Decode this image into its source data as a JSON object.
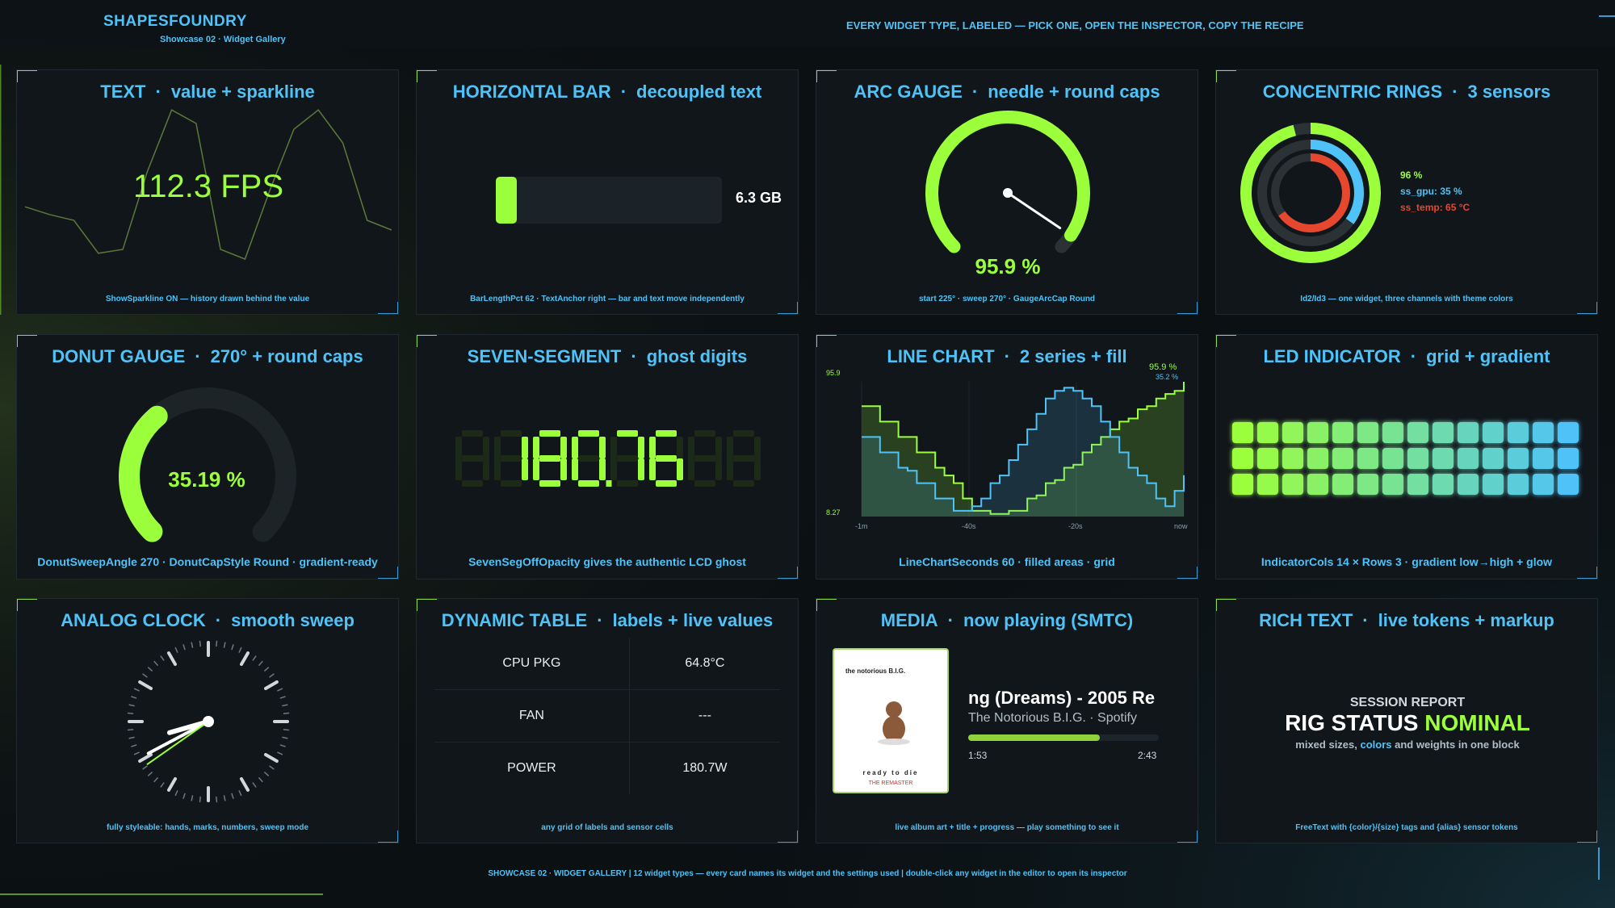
{
  "header": {
    "brand": "SHAPESFOUNDRY",
    "subtitle": "Showcase 02 · Widget Gallery",
    "tagline": "EVERY WIDGET TYPE, LABELED — PICK ONE, OPEN THE INSPECTOR, COPY THE RECIPE"
  },
  "footer": {
    "text": "SHOWCASE 02 · WIDGET GALLERY | 12 widget types — every card names its widget and the settings used | double-click any widget in the editor to open its inspector"
  },
  "colors": {
    "accent_blue": "#4fc3f7",
    "accent_green": "#9cff3c",
    "card_bg": "#11161b",
    "page_bg": "#0b1013",
    "temp_red": "#e5472f"
  },
  "cards": {
    "text": {
      "title": "TEXT",
      "subtitle": "value + sparkline",
      "value": "112.3 FPS",
      "caption": "ShowSparkline ON — history drawn behind the value",
      "sparkline": [
        0.42,
        0.38,
        0.35,
        0.18,
        0.2,
        0.6,
        0.92,
        0.85,
        0.2,
        0.15,
        0.5,
        0.82,
        0.92,
        0.75,
        0.35,
        0.3
      ]
    },
    "hbar": {
      "title": "HORIZONTAL BAR",
      "subtitle": "decoupled text",
      "value_text": "6.3 GB",
      "caption": "BarLengthPct 62 · TextAnchor right — bar and text move independently"
    },
    "arc": {
      "title": "ARC GAUGE",
      "subtitle": "needle + round caps",
      "value": 95.9,
      "value_text": "95.9 %",
      "caption": "start 225° · sweep 270° · GaugeArcCap Round"
    },
    "rings": {
      "title": "CONCENTRIC RINGS",
      "subtitle": "3 sensors",
      "l1": "96 %",
      "l2": "ss_gpu: 35 %",
      "l3": "ss_temp: 65 °C",
      "v1": 96,
      "v2": 35,
      "v3": 65,
      "caption": "Id2/Id3 — one widget, three channels with theme colors"
    },
    "donut": {
      "title": "DONUT GAUGE",
      "subtitle": "270° + round caps",
      "value": 35.19,
      "value_text": "35.19 %",
      "caption": "DonutSweepAngle 270 · DonutCapStyle Round · gradient-ready"
    },
    "sevenseg": {
      "title": "SEVEN-SEGMENT",
      "subtitle": "ghost digits",
      "display": "180.76",
      "caption": "SevenSegOffOpacity gives the authentic LCD ghost"
    },
    "line": {
      "title": "LINE CHART",
      "subtitle": "2 series + fill",
      "caption": "LineChartSeconds 60 · filled areas · grid"
    },
    "led": {
      "title": "LED INDICATOR",
      "subtitle": "grid + gradient",
      "cols": 14,
      "rows": 3,
      "caption": "IndicatorCols 14 × Rows 3 · gradient low→high + glow"
    },
    "clock": {
      "title": "ANALOG CLOCK",
      "subtitle": "smooth sweep",
      "hour_angle": 254,
      "minute_angle": 242,
      "second_angle": 235,
      "caption": "fully styleable: hands, marks, numbers, sweep mode"
    },
    "table": {
      "title": "DYNAMIC TABLE",
      "subtitle": "labels + live values",
      "rows": [
        {
          "label": "CPU PKG",
          "value": "64.8°C"
        },
        {
          "label": "FAN",
          "value": "---"
        },
        {
          "label": "POWER",
          "value": "180.7W"
        }
      ],
      "caption": "any grid of labels and sensor cells"
    },
    "media": {
      "title": "MEDIA",
      "subtitle": "now playing (SMTC)",
      "album_top": "the notorious B.I.G.",
      "album_mid": "ready to die",
      "album_bottom": "THE REMASTER",
      "track": "ng (Dreams) - 2005 Re",
      "artist": "The Notorious B.I.G. · Spotify",
      "elapsed": "1:53",
      "duration": "2:43",
      "progress": 0.69,
      "caption": "live album art + title + progress — play something to see it"
    },
    "richtext": {
      "title": "RICH TEXT",
      "subtitle": "live tokens + markup",
      "line1": "SESSION REPORT",
      "line2a": "RIG STATUS ",
      "line2b": "NOMINAL",
      "line3a": "mixed sizes, ",
      "line3b": "colors",
      "line3c": " and weights in one block",
      "caption": "FreeText with {color}/{size} tags and {alias} sensor tokens"
    }
  },
  "chart_data": {
    "type": "line",
    "x_ticks": [
      "-1m",
      "-40s",
      "-20s",
      "now"
    ],
    "y_top_label": "95.9",
    "y_bottom_label": "8.27",
    "ylim": [
      8.27,
      95.9
    ],
    "series": [
      {
        "name": "95.9 %",
        "color": "#9cff3c",
        "values": [
          80,
          80,
          70,
          70,
          60,
          60,
          50,
          50,
          40,
          35,
          30,
          20,
          12,
          12,
          10,
          10,
          12,
          12,
          20,
          22,
          30,
          32,
          40,
          42,
          50,
          55,
          60,
          65,
          70,
          72,
          78,
          80,
          85,
          88,
          90,
          95.9
        ]
      },
      {
        "name": "35.2 %",
        "color": "#4fc3f7",
        "values": [
          60,
          60,
          50,
          50,
          40,
          38,
          30,
          30,
          20,
          20,
          12,
          12,
          15,
          20,
          30,
          35,
          45,
          55,
          65,
          75,
          85,
          90,
          92,
          90,
          85,
          80,
          70,
          60,
          50,
          40,
          35,
          30,
          20,
          15,
          25,
          35.2
        ]
      }
    ]
  }
}
